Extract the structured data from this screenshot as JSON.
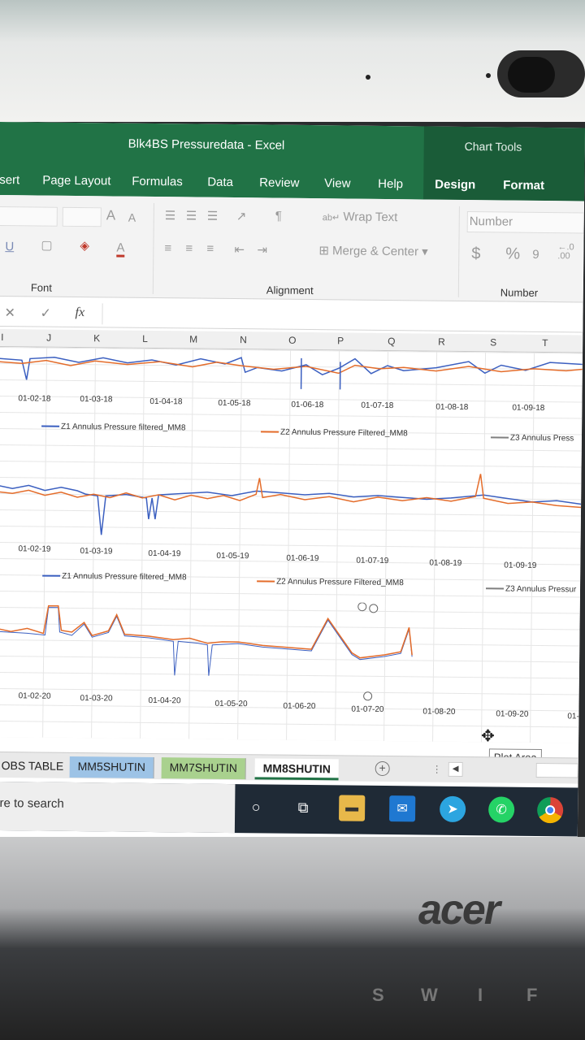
{
  "window": {
    "title": "Blk4BS Pressuredata  -  Excel",
    "context_tab_group": "Chart Tools"
  },
  "ribbon": {
    "tabs": [
      {
        "label": "sert"
      },
      {
        "label": "Page Layout"
      },
      {
        "label": "Formulas"
      },
      {
        "label": "Data"
      },
      {
        "label": "Review"
      },
      {
        "label": "View"
      },
      {
        "label": "Help"
      },
      {
        "label": "Design"
      },
      {
        "label": "Format"
      }
    ],
    "font_group": {
      "label": "Font",
      "grow": "A",
      "shrink": "A",
      "underline": "U",
      "font_color": "A"
    },
    "alignment_group": {
      "label": "Alignment",
      "wrap_text": "Wrap Text",
      "merge_center": "Merge & Center"
    },
    "number_group": {
      "label": "Number",
      "format_value": "Number",
      "currency": "$",
      "percent": "%",
      "comma": "9"
    }
  },
  "formula_bar": {
    "cancel": "✕",
    "enter": "✓",
    "fx": "fx"
  },
  "columns": [
    "I",
    "J",
    "K",
    "L",
    "M",
    "N",
    "O",
    "P",
    "Q",
    "R",
    "S",
    "T"
  ],
  "charts": {
    "chart2018": {
      "dates": [
        "01-02-18",
        "01-03-18",
        "01-04-18",
        "01-05-18",
        "01-06-18",
        "01-07-18",
        "01-08-18",
        "01-09-18"
      ]
    },
    "chart2019": {
      "dates": [
        "01-02-19",
        "01-03-19",
        "01-04-19",
        "01-05-19",
        "01-06-19",
        "01-07-19",
        "01-08-19",
        "01-09-19"
      ]
    },
    "chart2020": {
      "dates": [
        "01-02-20",
        "01-03-20",
        "01-04-20",
        "01-05-20",
        "01-06-20",
        "01-07-20",
        "01-08-20",
        "01-09-20",
        "01-"
      ]
    },
    "legend_2018": {
      "z1": "Z1 Annulus Pressure filtered_MM8",
      "z2": "Z2 Annulus Pressure Filtered_MM8",
      "z3": "Z3 Annulus Press"
    },
    "legend_2019": {
      "z1": "Z1 Annulus Pressure filtered_MM8",
      "z2": "Z2 Annulus Pressure Filtered_MM8",
      "z3": "Z3 Annulus Pressur"
    },
    "colors": {
      "z1": "#3b5fc0",
      "z2": "#e46c2a"
    }
  },
  "tooltip": "Plot Area",
  "sheet_tabs": [
    {
      "label": "OBS TABLE",
      "color": "#e9e9e9"
    },
    {
      "label": "MM5SHUTIN",
      "color": "#9dc3e6"
    },
    {
      "label": "MM7SHUTIN",
      "color": "#a9d18e"
    },
    {
      "label": "MM8SHUTIN",
      "color": "#ffffff"
    }
  ],
  "taskbar": {
    "search_text": "ere to search"
  },
  "laptop": {
    "brand": "acer",
    "keys": [
      "S",
      "W",
      "I",
      "F"
    ]
  }
}
